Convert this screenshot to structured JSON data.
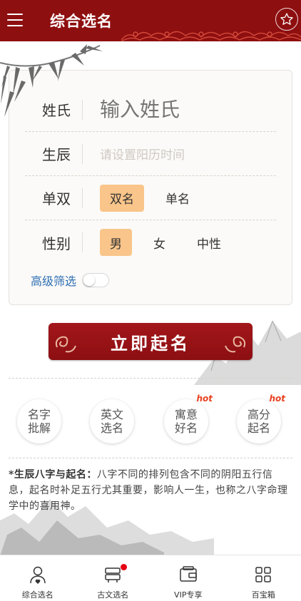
{
  "header": {
    "title": "综合选名",
    "menu_icon": "hamburger-menu-icon",
    "fav_icon": "star-icon",
    "colors": {
      "bar": "#8e0f10",
      "pattern": "#d44a3a"
    }
  },
  "form": {
    "surname": {
      "label": "姓氏",
      "placeholder": "输入姓氏"
    },
    "birth": {
      "label": "生辰",
      "placeholder": "请设置阳历时间"
    },
    "count": {
      "label": "单双",
      "options": [
        "双名",
        "单名"
      ],
      "selected": "双名"
    },
    "gender": {
      "label": "性别",
      "options": [
        "男",
        "女",
        "中性"
      ],
      "selected": "男"
    },
    "advanced": {
      "label": "高级筛选",
      "enabled": false
    },
    "colors": {
      "selected_option": "#f9c58a",
      "link": "#2d6fb3"
    }
  },
  "cta": {
    "label": "立即起名",
    "color": "#9e1418"
  },
  "features": [
    {
      "label": "名字批解",
      "hot": false
    },
    {
      "label": "英文选名",
      "hot": false
    },
    {
      "label": "寓意好名",
      "hot": true
    },
    {
      "label": "高分起名",
      "hot": true
    }
  ],
  "hot_badge": "hot",
  "description": {
    "title": "*生辰八字与起名：",
    "body": "八字不同的排列包含不同的阴阳五行信息，起名时补足五行尤其重要，影响人一生，也称之八字命理学中的喜用神。"
  },
  "bottom_nav": [
    {
      "label": "综合选名",
      "icon": "person-heart-icon",
      "badge": false
    },
    {
      "label": "古文选名",
      "icon": "book-stack-icon",
      "badge": true
    },
    {
      "label": "VIP专享",
      "icon": "wallet-icon",
      "badge": false
    },
    {
      "label": "百宝箱",
      "icon": "grid-icon",
      "badge": false
    }
  ]
}
